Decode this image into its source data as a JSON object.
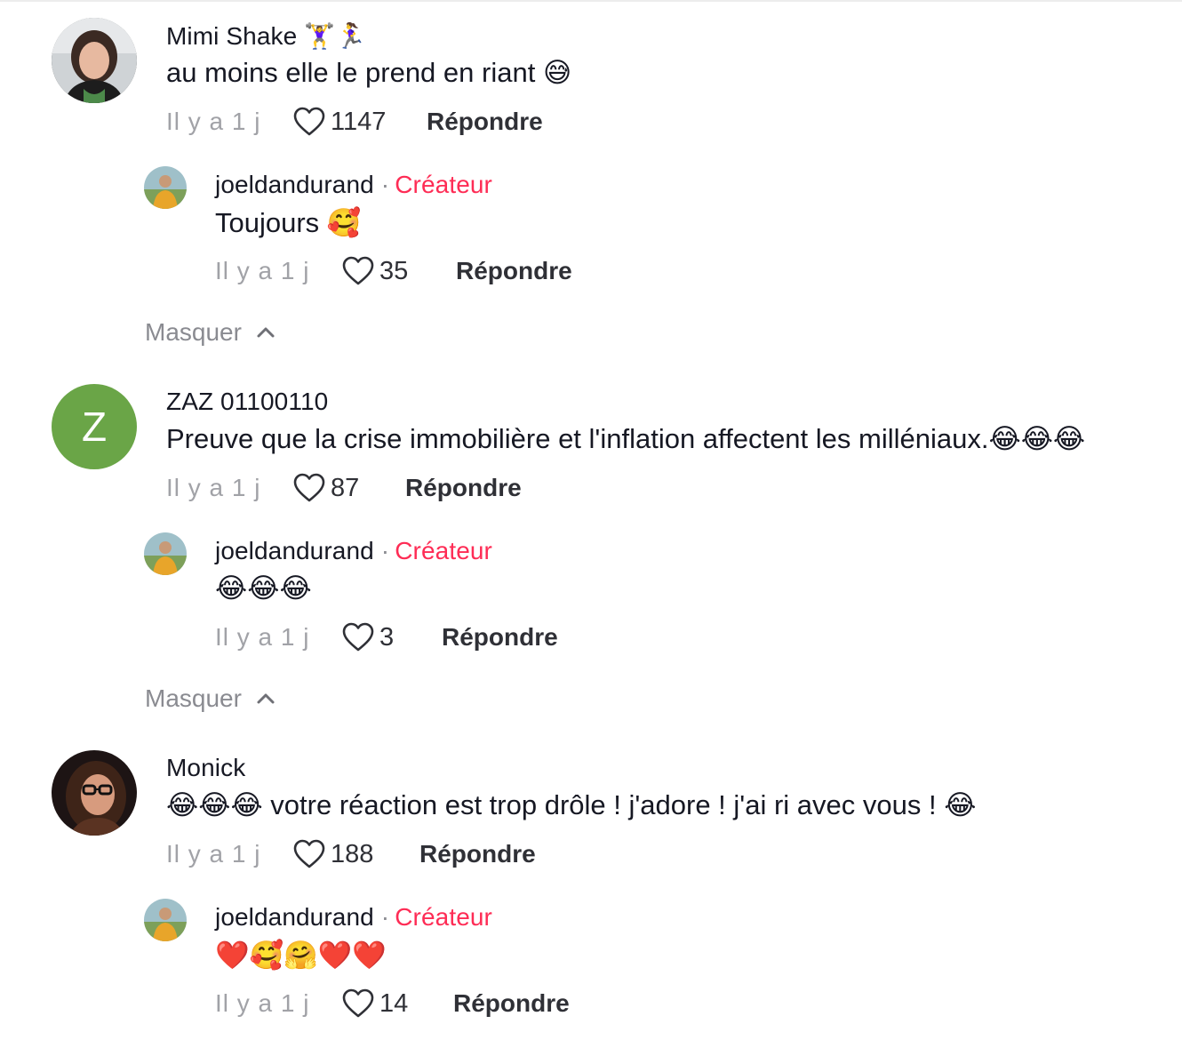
{
  "comments": [
    {
      "username": "Mimi Shake",
      "username_emoji": "🏋️‍♀️🏃‍♀️",
      "text": "au moins elle le prend en riant",
      "text_emoji": "😅",
      "time": "Il y a 1 j",
      "likes": "1147",
      "reply_label": "Répondre",
      "reply": {
        "username": "joeldandurand",
        "separator": "·",
        "tag": "Créateur",
        "text": "Toujours",
        "text_emoji": "🥰",
        "time": "Il y a 1 j",
        "likes": "35",
        "reply_label": "Répondre"
      },
      "hide_label": "Masquer"
    },
    {
      "username": "ZAZ 01100110",
      "avatar_letter": "Z",
      "text": "Preuve que la crise immobilière et l'inflation affectent les milléniaux.",
      "text_emoji": "😂😂😂",
      "time": "Il y a 1 j",
      "likes": "87",
      "reply_label": "Répondre",
      "reply": {
        "username": "joeldandurand",
        "separator": "·",
        "tag": "Créateur",
        "text": "",
        "text_emoji": "😂😂😂",
        "time": "Il y a 1 j",
        "likes": "3",
        "reply_label": "Répondre"
      },
      "hide_label": "Masquer"
    },
    {
      "username": "Monick",
      "text_emoji_prefix": "😂😂😂",
      "text": " votre réaction est trop drôle ! j'adore ! j'ai ri avec vous ! ",
      "text_emoji": "😂",
      "time": "Il y a 1 j",
      "likes": "188",
      "reply_label": "Répondre",
      "reply": {
        "username": "joeldandurand",
        "separator": "·",
        "tag": "Créateur",
        "text": "",
        "text_emoji": "❤️🥰🤗❤️❤️",
        "time": "Il y a 1 j",
        "likes": "14",
        "reply_label": "Répondre"
      }
    }
  ],
  "colors": {
    "creator_tag": "#fe2c55",
    "muted": "#a1a2a7",
    "zaz_avatar": "#6aa547"
  },
  "icons": [
    "heart-outline-icon",
    "chevron-up-icon"
  ]
}
